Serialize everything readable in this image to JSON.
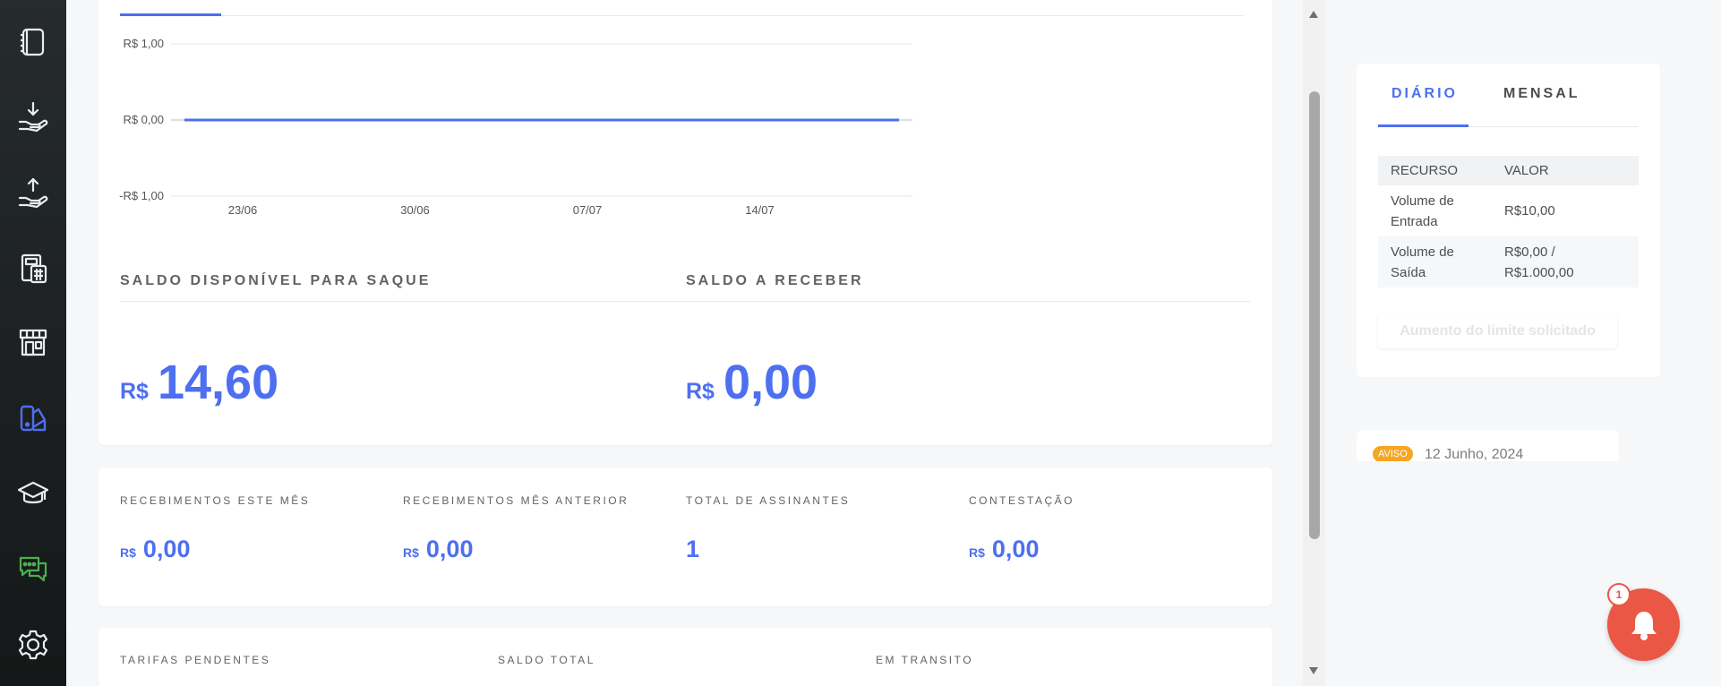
{
  "chart_data": {
    "type": "line",
    "y_ticks": [
      "R$ 1,00",
      "R$ 0,00",
      "-R$ 1,00"
    ],
    "x_ticks": [
      "23/06",
      "30/06",
      "07/07",
      "14/07"
    ],
    "ylim": [
      -1,
      1
    ],
    "series": [
      {
        "values": [
          0,
          0,
          0,
          0,
          0,
          0,
          0,
          0,
          0,
          0
        ]
      }
    ],
    "grid": true,
    "color": "#4d6ff0"
  },
  "balances": {
    "available_label": "SALDO DISPONÍVEL PARA SAQUE",
    "available_currency": "R$",
    "available_value": "14,60",
    "receivable_label": "SALDO A RECEBER",
    "receivable_currency": "R$",
    "receivable_value": "0,00"
  },
  "stats": [
    {
      "label": "RECEBIMENTOS ESTE MÊS",
      "currency": "R$",
      "value": "0,00"
    },
    {
      "label": "RECEBIMENTOS MÊS ANTERIOR",
      "currency": "R$",
      "value": "0,00"
    },
    {
      "label": "TOTAL DE ASSINANTES",
      "currency": "",
      "value": "1"
    },
    {
      "label": "CONTESTAÇÃO",
      "currency": "R$",
      "value": "0,00"
    }
  ],
  "bottom_stats": [
    {
      "label": "TARIFAS PENDENTES"
    },
    {
      "label": "SALDO TOTAL"
    },
    {
      "label": "EM TRANSITO"
    }
  ],
  "limits": {
    "tabs": [
      "DIÁRIO",
      "MENSAL"
    ],
    "headers": [
      "RECURSO",
      "VALOR"
    ],
    "rows": [
      {
        "resource_line1": "Volume de",
        "resource_line2": "Entrada",
        "value_line1": "R$10,00",
        "value_line2": ""
      },
      {
        "resource_line1": "Volume de",
        "resource_line2": "Saída",
        "value_line1": "R$0,00 /",
        "value_line2": "R$1.000,00"
      }
    ],
    "button": "Aumento do limite solicitado"
  },
  "notice": {
    "badge": "AVISO",
    "date": "12 Junho, 2024"
  },
  "notifications": {
    "count": "1"
  },
  "colors": {
    "accent": "#4d6ff0",
    "bell": "#ea5744",
    "badge": "#f5a623",
    "sidebar_icon": "#e9ecec",
    "sidebar_active": "#4d6ff0",
    "sidebar_chat": "#4caf50"
  },
  "sidebar_icons": [
    "notebook-icon",
    "deposit-hand-icon",
    "withdraw-hand-icon",
    "calculator-icon",
    "store-icon",
    "palette-icon",
    "graduation-cap-icon",
    "chat-bubbles-icon",
    "settings-gear-icon"
  ]
}
